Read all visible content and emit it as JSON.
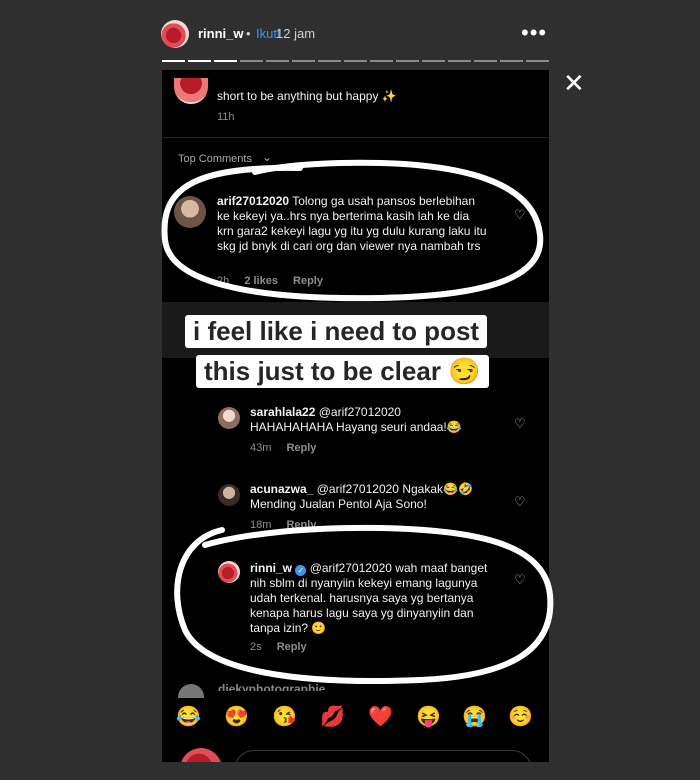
{
  "story": {
    "username": "rinni_w",
    "separator": "•",
    "follow_label": "Ikuti",
    "time_ago": "12 jam",
    "more_icon": "more-options-icon",
    "close_icon": "close-icon",
    "progress_total": 15,
    "progress_done": 3
  },
  "caption_comment": {
    "text": "short to be anything but happy ✨",
    "time": "11h"
  },
  "top_comments_label": "Top Comments",
  "top_comment": {
    "username": "arif27012020",
    "text": "Tolong ga usah pansos berlebihan ke kekeyi ya..hrs nya berterima kasih lah ke dia krn gara2 kekeyi lagu yg itu  yg dulu kurang laku itu skg jd bnyk di cari org dan viewer nya nambah trs",
    "time": "2h",
    "likes": "2 likes",
    "reply": "Reply"
  },
  "overlay_caption": {
    "line1": "i feel like i need to post",
    "line2": "this just to be clear 😏"
  },
  "replies": [
    {
      "username": "sarahlala22",
      "mention": "@arif27012020",
      "text": "HAHAHAHAHA Hayang seuri andaa!😂",
      "time": "43m",
      "reply": "Reply"
    },
    {
      "username": "acunazwa_",
      "mention": "@arif27012020",
      "text_line1": "Ngakak😂🤣",
      "text_line2": "Mending Jualan Pentol Aja Sono!",
      "time": "18m",
      "reply": "Reply"
    },
    {
      "username": "rinni_w",
      "verified": true,
      "mention": "@arif27012020",
      "text": "wah maaf banget nih sblm di nyanyiin kekeyi emang lagunya udah terkenal. harusnya saya yg bertanya kenapa harus lagu saya yg dinyanyiin dan tanpa izin? 🙂",
      "time": "2s",
      "reply": "Reply"
    }
  ],
  "partial_next_user": "diekyphotographie",
  "emoji_bar": [
    "😂",
    "😍",
    "😘",
    "💋",
    "❤️",
    "😝",
    "😭",
    "☺️"
  ],
  "colors": {
    "background": "#2f2f2f",
    "panel": "#000000",
    "follow_blue": "#3797f0",
    "verified_blue": "#3897f0",
    "scribble": "#ffffff"
  }
}
